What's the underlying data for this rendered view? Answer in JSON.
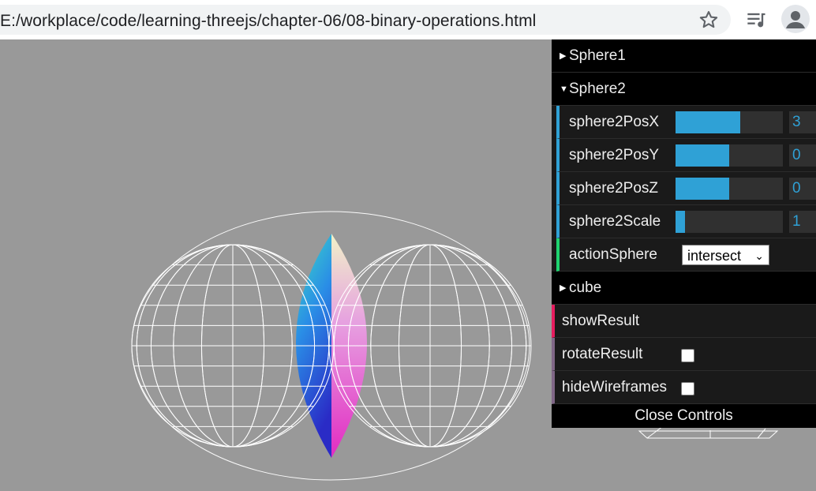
{
  "browser": {
    "url": "E:/workplace/code/learning-threejs/chapter-06/08-binary-operations.html"
  },
  "gui": {
    "folders": {
      "sphere1": "Sphere1",
      "sphere2": "Sphere2",
      "cube": "cube"
    },
    "sphere2": {
      "posx": {
        "label": "sphere2PosX",
        "value": "3",
        "fill": 0.6
      },
      "posy": {
        "label": "sphere2PosY",
        "value": "0",
        "fill": 0.5
      },
      "posz": {
        "label": "sphere2PosZ",
        "value": "0",
        "fill": 0.5
      },
      "scale": {
        "label": "sphere2Scale",
        "value": "1",
        "fill": 0.09
      },
      "action": {
        "label": "actionSphere",
        "selected": "intersect"
      }
    },
    "showResult": "showResult",
    "rotateResult": "rotateResult",
    "hideWireframes": "hideWireframes",
    "close": "Close Controls"
  },
  "colors": {
    "viewport_bg": "#999999",
    "slider": "#2fa1d6",
    "gui_bg": "#1a1a1a"
  }
}
